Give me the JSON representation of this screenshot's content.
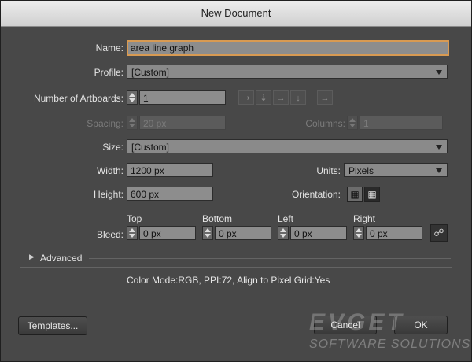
{
  "window": {
    "title": "New Document"
  },
  "form": {
    "name_label": "Name:",
    "name_value": "area line graph",
    "profile_label": "Profile:",
    "profile_value": "[Custom]",
    "artboards_label": "Number of Artboards:",
    "artboards_value": "1",
    "spacing_label": "Spacing:",
    "spacing_value": "20 px",
    "columns_label": "Columns:",
    "columns_value": "1",
    "size_label": "Size:",
    "size_value": "[Custom]",
    "width_label": "Width:",
    "width_value": "1200 px",
    "units_label": "Units:",
    "units_value": "Pixels",
    "height_label": "Height:",
    "height_value": "600 px",
    "orientation_label": "Orientation:",
    "bleed_label": "Bleed:",
    "bleed": {
      "top_label": "Top",
      "top_value": "0 px",
      "bottom_label": "Bottom",
      "bottom_value": "0 px",
      "left_label": "Left",
      "left_value": "0 px",
      "right_label": "Right",
      "right_value": "0 px"
    },
    "advanced_label": "Advanced",
    "summary": "Color Mode:RGB, PPI:72, Align to Pixel Grid:Yes"
  },
  "buttons": {
    "templates": "Templates...",
    "cancel": "Cancel",
    "ok": "OK"
  },
  "watermark": {
    "brand": "EVGET",
    "tagline": "SOFTWARE SOLUTIONS"
  },
  "icons": {
    "grid_by_row": "grid-by-row-icon",
    "grid_by_column": "grid-by-column-icon",
    "arrange_by_row": "arrange-by-row-icon",
    "arrange_by_column": "arrange-by-column-icon",
    "change_to_rtl": "right-to-left-icon",
    "portrait": "portrait-icon",
    "landscape": "landscape-icon",
    "link": "link-icon"
  },
  "colors": {
    "focus_border": "#d89a52",
    "dialog_bg": "#484848"
  }
}
